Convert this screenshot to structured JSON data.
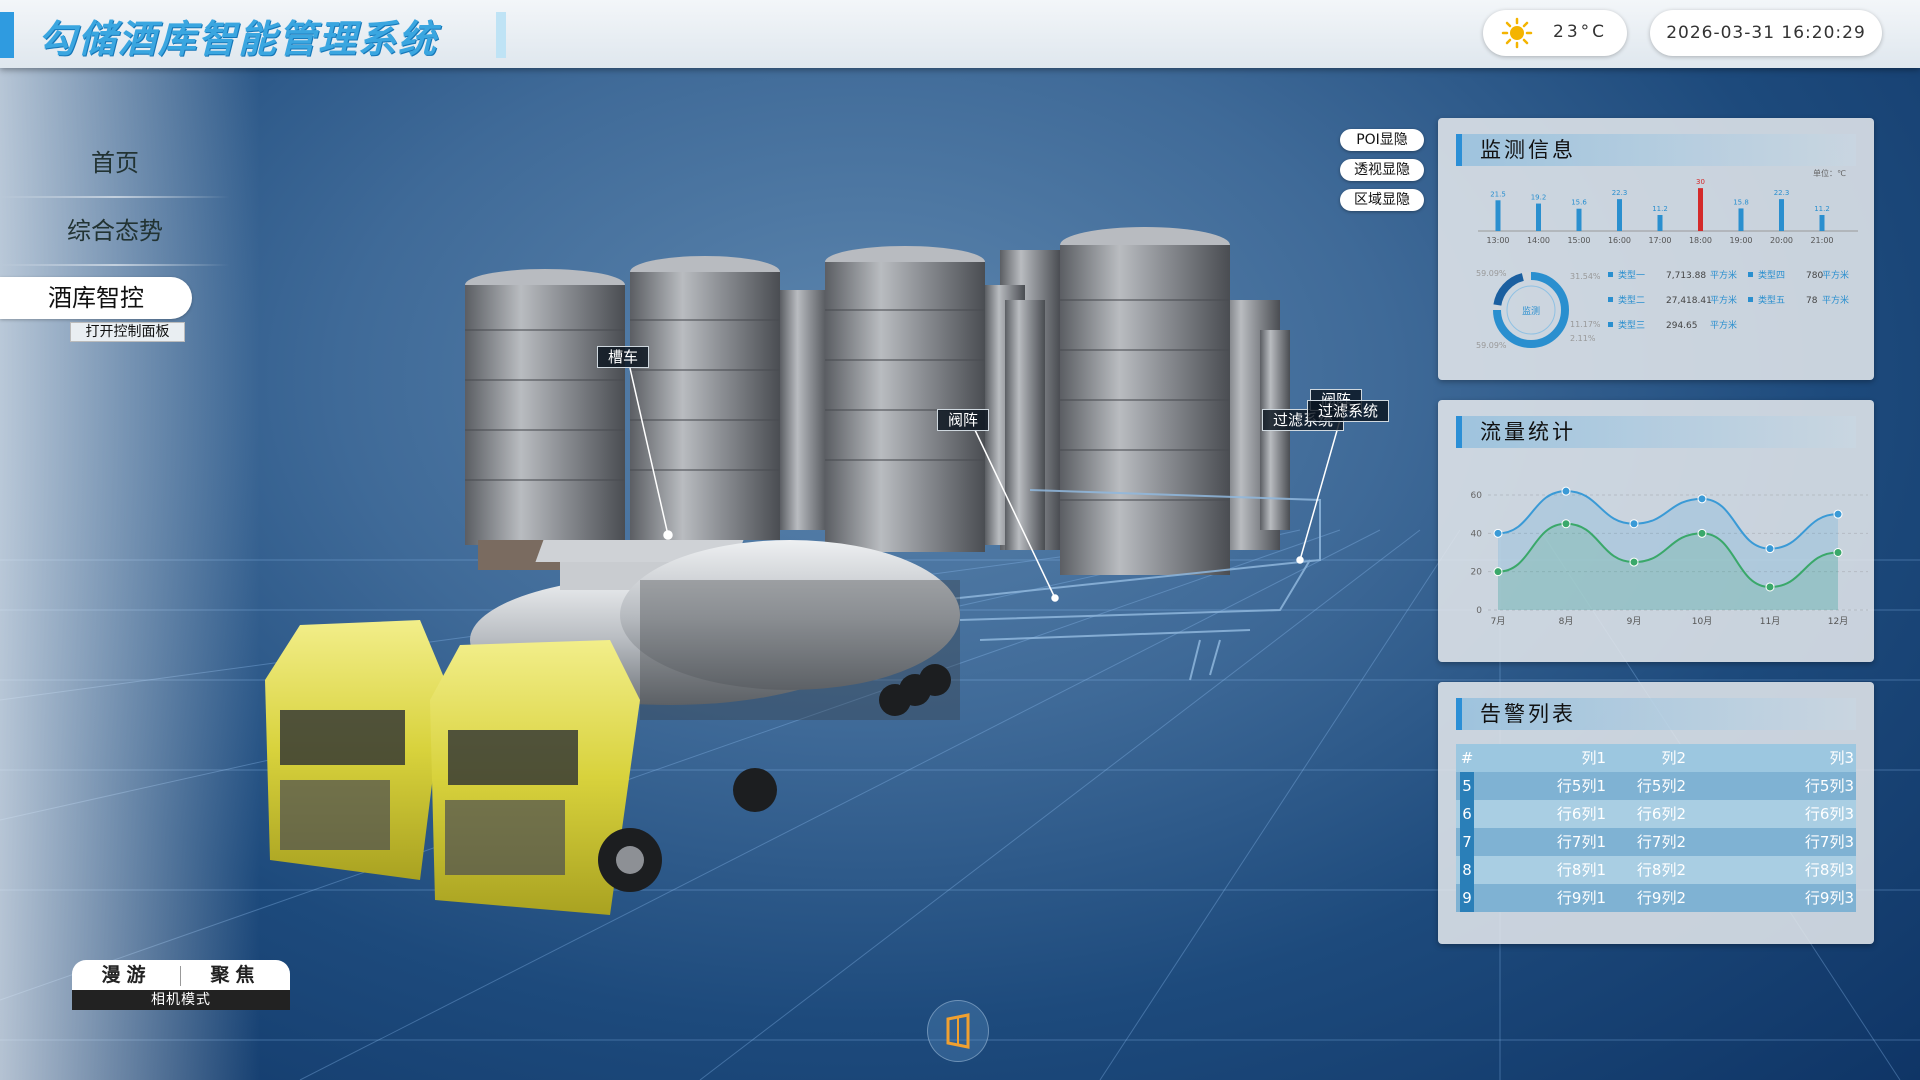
{
  "header": {
    "title": "勾储酒库智能管理系统",
    "temperature": "23°C",
    "datetime": "2026-03-31 16:20:29"
  },
  "menu": {
    "items": [
      "首页",
      "综合态势"
    ],
    "active": "酒库智控",
    "open_panel": "打开控制面板"
  },
  "camera": {
    "roam": "漫游",
    "focus": "聚焦",
    "label": "相机模式"
  },
  "poi_toggles": [
    "POI显隐",
    "透视显隐",
    "区域显隐"
  ],
  "scene_tags": {
    "tanker": "槽车",
    "valve1": "阀阵",
    "filter1": "过滤系统",
    "valve2": "阀阵",
    "filter2": "过滤系统"
  },
  "monitor": {
    "title": "监测信息",
    "unit": "单位：℃",
    "bar_chart": {
      "type": "bar",
      "categories": [
        "13:00",
        "14:00",
        "15:00",
        "16:00",
        "17:00",
        "18:00",
        "19:00",
        "20:00",
        "21:00"
      ],
      "values": [
        21.5,
        19.2,
        15.6,
        22.3,
        11.2,
        30,
        15.8,
        22.3,
        11.2
      ],
      "highlight_index": 5
    },
    "donut": {
      "center_label": "监测",
      "left_top": "59.09%",
      "left_bottom": "59.09%",
      "right_labels": [
        "31.54%",
        "11.17%",
        "2.11%"
      ]
    },
    "legend": [
      {
        "name": "类型一",
        "value": "7,713.88",
        "unit": "平方米"
      },
      {
        "name": "类型二",
        "value": "27,418.41",
        "unit": "平方米"
      },
      {
        "name": "类型三",
        "value": "294.65",
        "unit": "平方米"
      },
      {
        "name": "类型四",
        "value": "780",
        "unit": "平方米"
      },
      {
        "name": "类型五",
        "value": "78",
        "unit": "平方米"
      }
    ],
    "colors": {
      "bar": "#2a8fcf",
      "highlight": "#d42a2a"
    }
  },
  "flow": {
    "title": "流量统计",
    "chart_data": {
      "type": "line",
      "categories": [
        "7月",
        "8月",
        "9月",
        "10月",
        "11月",
        "12月"
      ],
      "ylim": [
        0,
        60
      ],
      "yticks": [
        0,
        20,
        40,
        60
      ],
      "series": [
        {
          "values": [
            40,
            62,
            45,
            58,
            32,
            50
          ],
          "color": "#3a9ad6"
        },
        {
          "values": [
            20,
            45,
            25,
            40,
            12,
            30
          ],
          "color": "#3aa86a"
        }
      ]
    }
  },
  "alarm": {
    "title": "告警列表",
    "columns": [
      "#",
      "列1",
      "列2",
      "列3"
    ],
    "rows": [
      [
        "5",
        "行5列1",
        "行5列2",
        "行5列3"
      ],
      [
        "6",
        "行6列1",
        "行6列2",
        "行6列3"
      ],
      [
        "7",
        "行7列1",
        "行7列2",
        "行7列3"
      ],
      [
        "8",
        "行8列1",
        "行8列2",
        "行8列3"
      ],
      [
        "9",
        "行9列1",
        "行9列2",
        "行9列3"
      ]
    ]
  }
}
